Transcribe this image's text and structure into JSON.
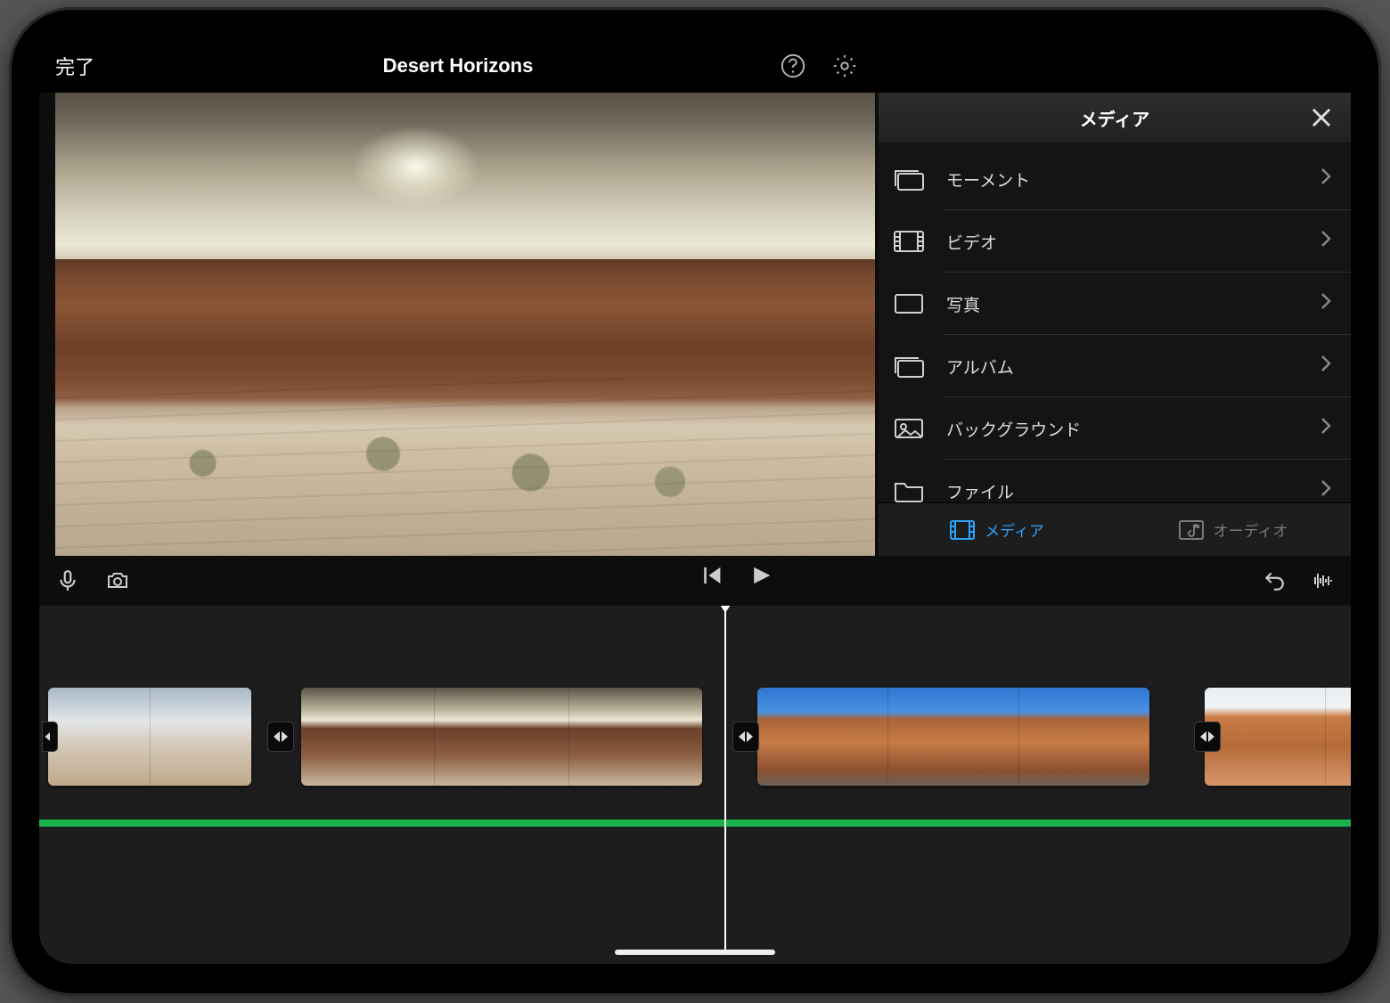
{
  "header": {
    "done_label": "完了",
    "project_title": "Desert Horizons"
  },
  "media_panel": {
    "title": "メディア",
    "items": [
      {
        "label": "モーメント"
      },
      {
        "label": "ビデオ"
      },
      {
        "label": "写真"
      },
      {
        "label": "アルバム"
      },
      {
        "label": "バックグラウンド"
      },
      {
        "label": "ファイル"
      }
    ],
    "tabs": {
      "media_label": "メディア",
      "audio_label": "オーディオ"
    }
  }
}
